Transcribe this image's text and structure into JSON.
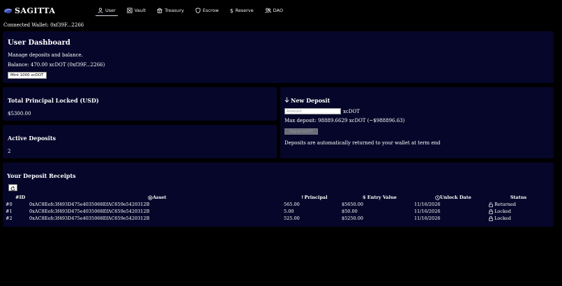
{
  "app": {
    "name": "SAGITTA"
  },
  "nav": [
    {
      "label": "User",
      "icon": "user-icon",
      "active": true
    },
    {
      "label": "Vault",
      "icon": "vault-icon",
      "active": false
    },
    {
      "label": "Treasury",
      "icon": "treasury-icon",
      "active": false
    },
    {
      "label": "Escrow",
      "icon": "shield-icon",
      "active": false
    },
    {
      "label": "Reserve",
      "icon": "dollar-icon",
      "active": false
    },
    {
      "label": "DAO",
      "icon": "users-icon",
      "active": false
    }
  ],
  "wallet": {
    "text": "Connected Wallet: 0xf39F...2266"
  },
  "dashboard": {
    "title": "User Dashboard",
    "subtitle": "Manage deposits and balance.",
    "balance": "Balance: 470.00 xcDOT (0xf39F...2266)",
    "mint_label": "Mint 1000 xcDOT"
  },
  "principal": {
    "title": "Total Principal Locked (USD)",
    "value": "$5300.00"
  },
  "active": {
    "title": "Active Deposits",
    "value": "2"
  },
  "new_deposit": {
    "title": "New Deposit",
    "placeholder": "Amount",
    "unit": "xcDOT",
    "max": "Max deposit: 98889.6629 xcDOT (~$988896.63)",
    "button_label": "Deposit xcDOT",
    "note": "Deposits are automatically returned to your wallet at term end"
  },
  "receipts": {
    "title": "Your Deposit Receipts",
    "headers": {
      "id": "ID",
      "asset": "Asset",
      "principal": "Principal",
      "entry": "Entry Value",
      "unlock": "Unlock Date",
      "status": "Status"
    },
    "rows": [
      {
        "id": "#0",
        "asset": "0xAC8Eefc3f493D475e4035068EfAC659e5420312B",
        "principal": "565.00",
        "entry": "$5650.00",
        "unlock": "11/16/2026",
        "status": "Returned"
      },
      {
        "id": "#1",
        "asset": "0xAC8Eefc3f493D475e4035068EfAC659e5420312B",
        "principal": "5.00",
        "entry": "$50.00",
        "unlock": "11/16/2026",
        "status": "Locked"
      },
      {
        "id": "#2",
        "asset": "0xAC8Eefc3f493D475e4035068EfAC659e5420312B",
        "principal": "525.00",
        "entry": "$5250.00",
        "unlock": "11/16/2026",
        "status": "Locked"
      }
    ]
  },
  "colors": {
    "background": "#000000",
    "card": "#06062a",
    "text": "#ffffff"
  }
}
